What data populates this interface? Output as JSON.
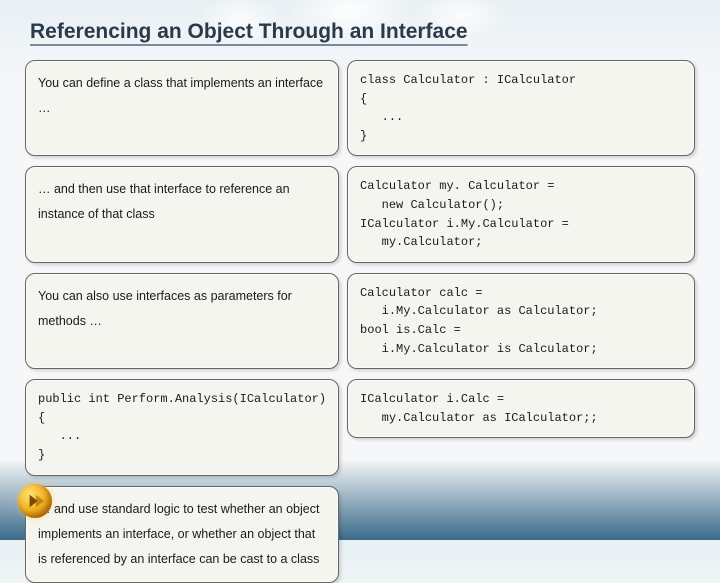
{
  "title": "Referencing an Object Through an Interface",
  "rows": [
    {
      "text": "You can define a class that implements an interface …",
      "code": "class Calculator : ICalculator\n{\n   ...\n}"
    },
    {
      "text": "… and then use that interface to reference an instance of that class",
      "code": "Calculator my. Calculator =\n   new Calculator();\nICalculator i.My.Calculator =\n   my.Calculator;"
    },
    {
      "text": "You can also use interfaces as parameters for methods …",
      "code": "public int Perform.Analysis(ICalculator)\n{\n   ...\n}"
    },
    {
      "text": "… and use standard logic to test whether an object implements an interface, or whether an object that is referenced by an interface can be cast to a class",
      "code_a": "Calculator calc =\n   i.My.Calculator as Calculator;\nbool is.Calc =\n   i.My.Calculator is Calculator;",
      "code_b": "ICalculator i.Calc =\n   my.Calculator as ICalculator;;"
    }
  ]
}
